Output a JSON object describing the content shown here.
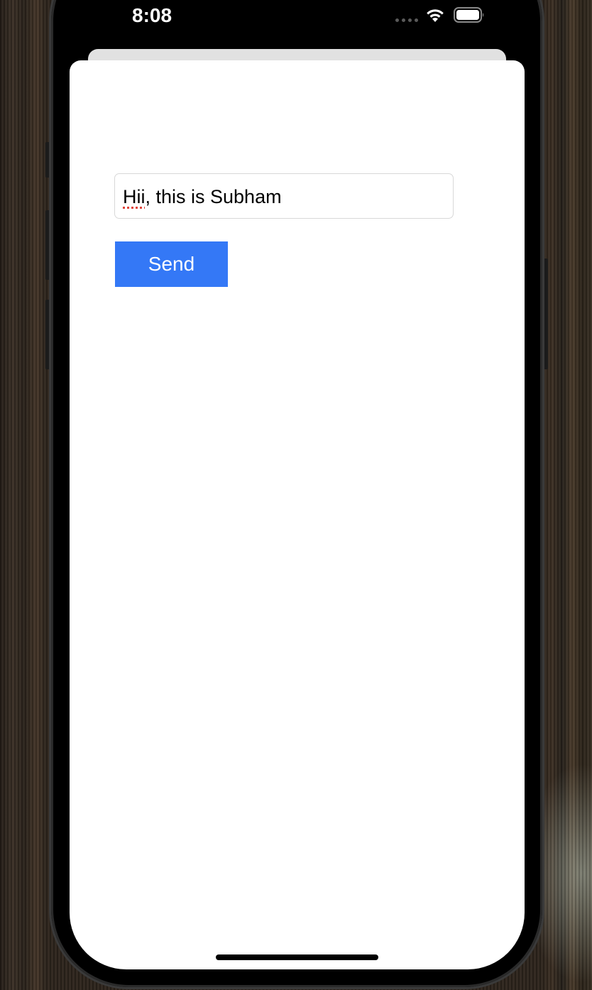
{
  "status_bar": {
    "time": "8:08",
    "icons": [
      "cellular-signal-icon",
      "wifi-icon",
      "battery-icon"
    ]
  },
  "form": {
    "message_input": {
      "value_misspelled_word": "Hii",
      "value_rest": ", this is Subham"
    },
    "send_label": "Send"
  },
  "colors": {
    "accent": "#3478f6",
    "spellcheck_underline": "#e0443a",
    "sheet_background": "#ffffff"
  }
}
